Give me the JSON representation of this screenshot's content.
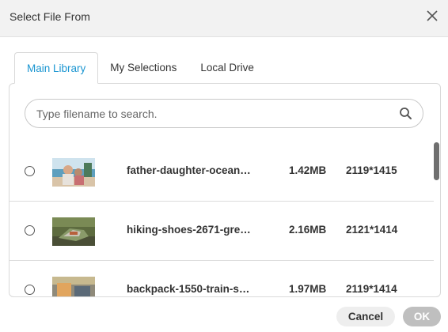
{
  "dialog": {
    "title": "Select File From"
  },
  "tabs": [
    {
      "label": "Main Library",
      "active": true
    },
    {
      "label": "My Selections",
      "active": false
    },
    {
      "label": "Local Drive",
      "active": false
    }
  ],
  "search": {
    "placeholder": "Type filename to search.",
    "value": ""
  },
  "files": [
    {
      "name": "father-daughter-ocean…",
      "size": "1.42MB",
      "dimensions": "2119*1415",
      "thumbnail": "beach-photo",
      "selected": false
    },
    {
      "name": "hiking-shoes-2671-gre…",
      "size": "2.16MB",
      "dimensions": "2121*1414",
      "thumbnail": "hiking-photo",
      "selected": false
    },
    {
      "name": "backpack-1550-train-s…",
      "size": "1.97MB",
      "dimensions": "2119*1414",
      "thumbnail": "train-photo",
      "selected": false
    }
  ],
  "footer": {
    "cancel_label": "Cancel",
    "ok_label": "OK"
  },
  "colors": {
    "accent": "#1a95d1",
    "header_bg": "#f2f2f2",
    "ok_disabled": "#bfbfbf",
    "cancel_bg": "#eeeeee"
  },
  "icons": {
    "close": "close-icon",
    "search": "search-icon"
  }
}
